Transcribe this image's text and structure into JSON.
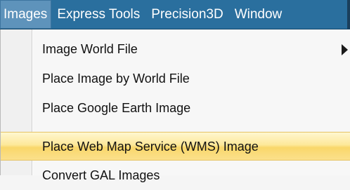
{
  "menubar": {
    "items": [
      {
        "label": "Images",
        "active": true
      },
      {
        "label": "Express Tools",
        "active": false
      },
      {
        "label": "Precision3D",
        "active": false
      },
      {
        "label": "Window",
        "active": false
      }
    ]
  },
  "dropdown": {
    "items": [
      {
        "label": "Image World File",
        "has_submenu": true,
        "highlighted": false
      },
      {
        "label": "Place Image by World File",
        "has_submenu": false,
        "highlighted": false
      },
      {
        "label": "Place Google Earth Image",
        "has_submenu": false,
        "highlighted": false
      },
      {
        "label": "Place Web Map Service (WMS) Image",
        "has_submenu": false,
        "highlighted": true
      },
      {
        "label": "Convert GAL Images",
        "has_submenu": false,
        "highlighted": false
      }
    ]
  },
  "colors": {
    "menubar_bg": "#2a6f9e",
    "menubar_active_bg": "#5e93bb",
    "highlight": "#fde89a"
  },
  "icons": {
    "submenu": "submenu-arrow-icon"
  }
}
